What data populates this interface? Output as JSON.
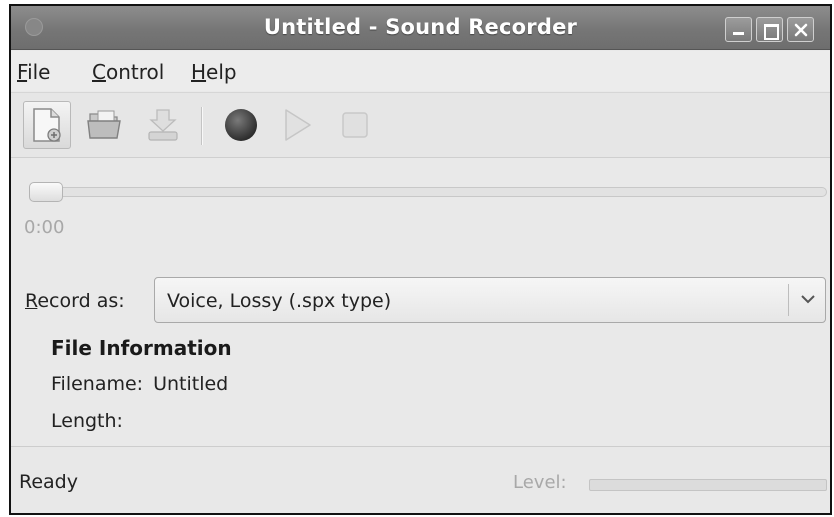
{
  "window": {
    "title": "Untitled - Sound Recorder",
    "buttons": [
      "minimize",
      "maximize",
      "close"
    ]
  },
  "menubar": {
    "items": [
      {
        "label": "File",
        "mnemonic": "F",
        "rest": "ile"
      },
      {
        "label": "Control",
        "mnemonic": "C",
        "rest": "ontrol"
      },
      {
        "label": "Help",
        "mnemonic": "H",
        "rest": "elp"
      }
    ]
  },
  "toolbar": {
    "buttons": [
      {
        "icon": "new-file-icon",
        "state": "pressed"
      },
      {
        "icon": "open-folder-icon",
        "state": "enabled"
      },
      {
        "icon": "save-icon",
        "state": "disabled"
      },
      {
        "icon": "record-icon",
        "state": "enabled"
      },
      {
        "icon": "play-icon",
        "state": "disabled"
      },
      {
        "icon": "stop-icon",
        "state": "disabled"
      }
    ]
  },
  "position": {
    "time": "0:00",
    "value": 0
  },
  "record": {
    "label_mnemonic": "R",
    "label_rest": "ecord as:",
    "format": "Voice, Lossy (.spx type)"
  },
  "file_info": {
    "heading": "File Information",
    "filename_label": "Filename:",
    "filename_value": "Untitled",
    "length_label": "Length:",
    "length_value": ""
  },
  "status": {
    "text": "Ready",
    "level_label": "Level:",
    "level_value": 0
  }
}
